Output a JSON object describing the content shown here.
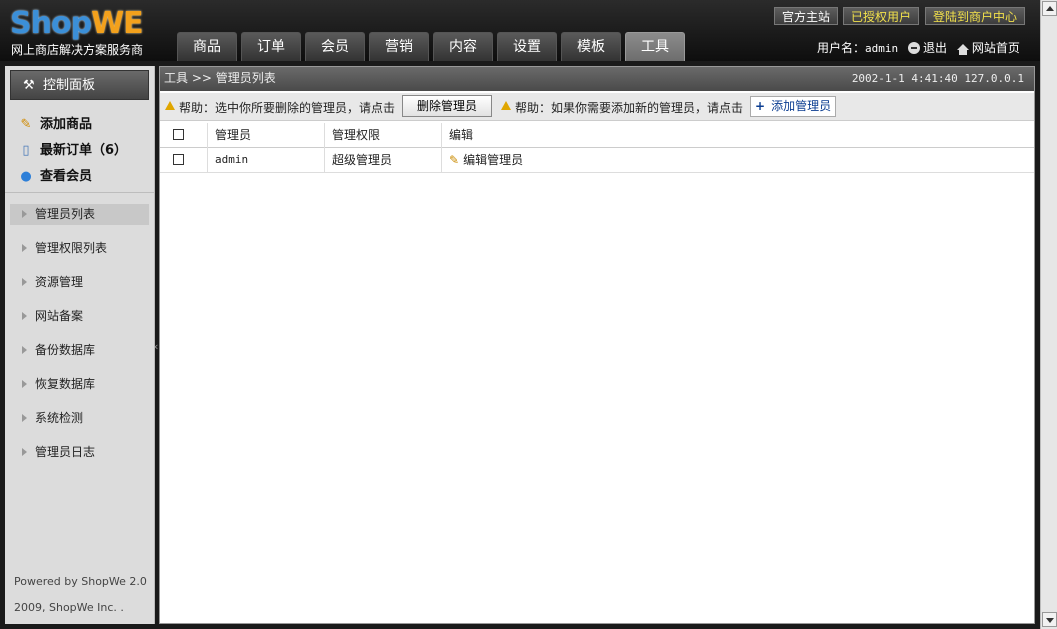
{
  "header": {
    "logo_part1": "Shop",
    "logo_part2": "WE",
    "slogan": "网上商店解决方案服务商",
    "top_links": [
      "官方主站",
      "已授权用户",
      "登陆到商户中心"
    ],
    "nav_tabs": [
      "商品",
      "订单",
      "会员",
      "营销",
      "内容",
      "设置",
      "模板",
      "工具"
    ],
    "active_tab": "工具",
    "user_label": "用户名：",
    "username": "admin",
    "logout": "退出",
    "home": "网站首页"
  },
  "sidebar": {
    "panel_title": "控制面板",
    "quick_links": [
      {
        "label": "添加商品",
        "icon": "pencil-icon"
      },
      {
        "label": "最新订单（6）",
        "icon": "document-icon"
      },
      {
        "label": "查看会员",
        "icon": "user-icon"
      }
    ],
    "menu": [
      "管理员列表",
      "管理权限列表",
      "资源管理",
      "网站备案",
      "备份数据库",
      "恢复数据库",
      "系统检测",
      "管理员日志"
    ],
    "active_menu": "管理员列表",
    "powered_by": "Powered by ShopWe 2.0",
    "copyright": "2009, ShopWe Inc. ."
  },
  "main": {
    "breadcrumb": "工具 >> 管理员列表",
    "datetime": "2002-1-1 4:41:40 127.0.0.1",
    "help_delete": "帮助：选中你所要删除的管理员，请点击",
    "delete_button": "删除管理员",
    "help_add": "帮助：如果你需要添加新的管理员，请点击",
    "add_button": "添加管理员",
    "table": {
      "headers": [
        "管理员",
        "管理权限",
        "编辑"
      ],
      "rows": [
        {
          "name": "admin",
          "role": "超级管理员",
          "edit": "编辑管理员"
        }
      ]
    }
  },
  "colors": {
    "logo_blue": "#3b8fd8",
    "logo_orange": "#f3a11c",
    "link_yellow": "#f2e14b",
    "header_dark": "#1a1a1a"
  }
}
